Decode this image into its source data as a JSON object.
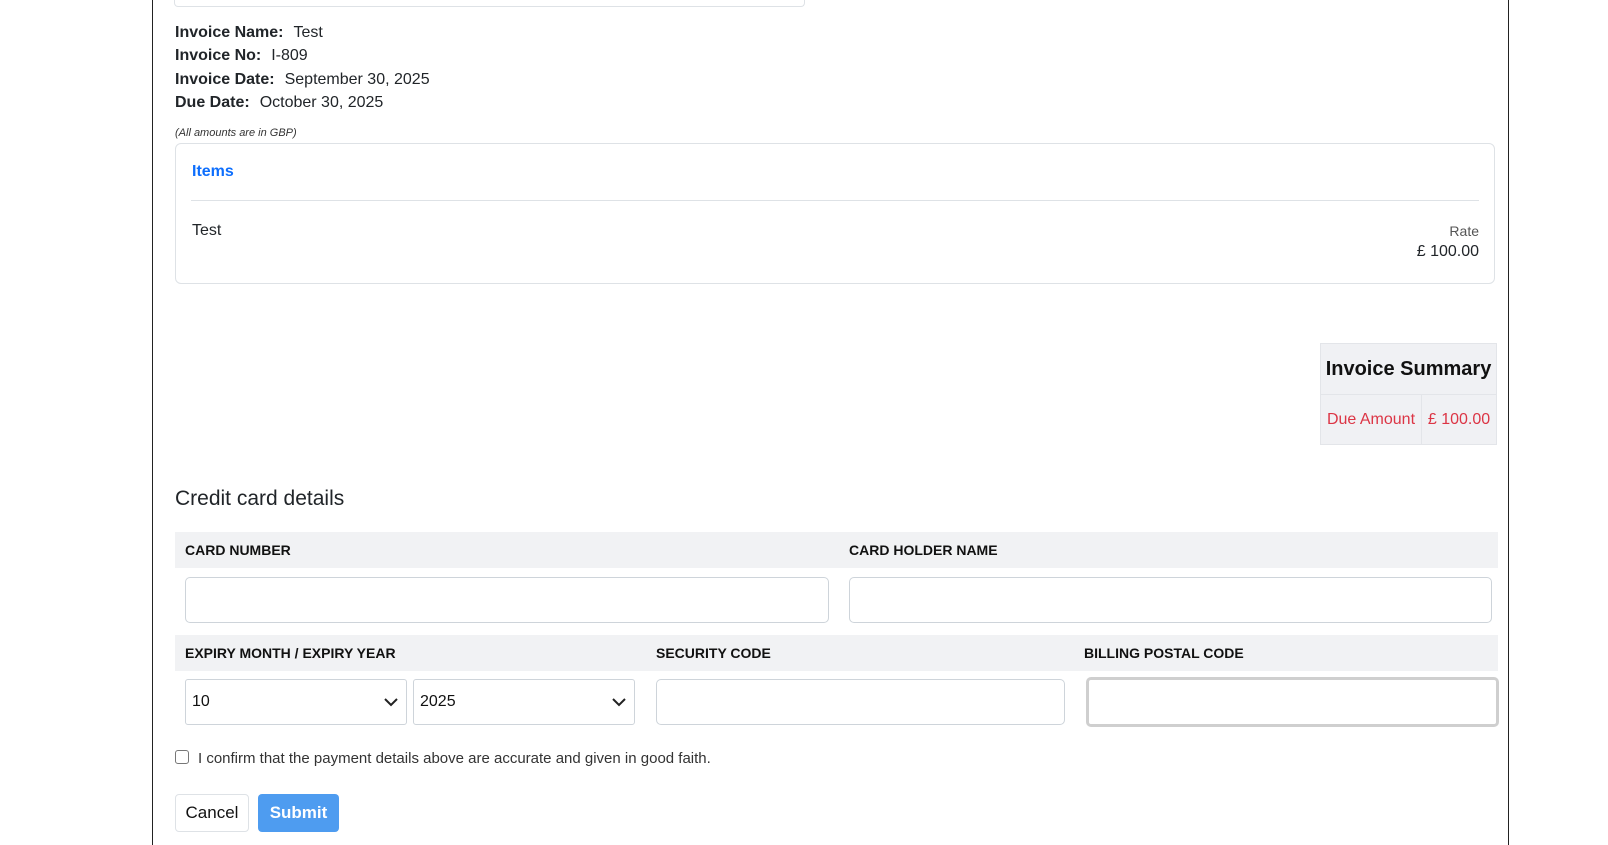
{
  "invoice": {
    "name_label": "Invoice Name:",
    "name_value": "Test",
    "no_label": "Invoice No:",
    "no_value": "I-809",
    "date_label": "Invoice Date:",
    "date_value": "September 30, 2025",
    "due_label": "Due Date:",
    "due_value": "October 30, 2025",
    "amounts_note": "(All amounts are in GBP)"
  },
  "items": {
    "title": "Items",
    "rows": [
      {
        "name": "Test",
        "rate_label": "Rate",
        "rate": "£ 100.00"
      }
    ]
  },
  "summary": {
    "title": "Invoice Summary",
    "due_label": "Due Amount",
    "due_value": "£ 100.00",
    "accent_color": "#dc3545"
  },
  "credit_card": {
    "title": "Credit card details",
    "card_number_label": "CARD NUMBER",
    "card_number_value": "",
    "card_holder_label": "CARD HOLDER NAME",
    "card_holder_value": "",
    "expiry_label": "EXPIRY MONTH / EXPIRY YEAR",
    "expiry_month": "10",
    "expiry_year": "2025",
    "security_label": "SECURITY CODE",
    "security_value": "",
    "postal_label": "BILLING POSTAL CODE",
    "postal_value": ""
  },
  "confirm": {
    "text": "I confirm that the payment details above are accurate and given in good faith.",
    "checked": false
  },
  "actions": {
    "cancel_label": "Cancel",
    "submit_label": "Submit",
    "submit_color": "#4e9cf0"
  }
}
